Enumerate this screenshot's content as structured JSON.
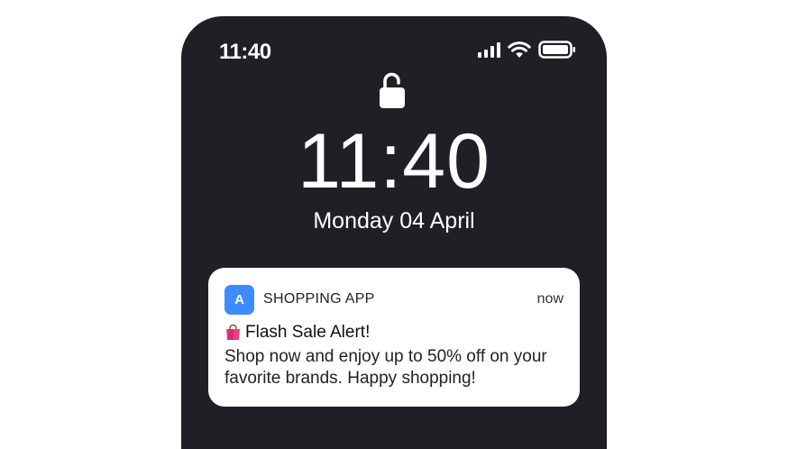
{
  "status_bar": {
    "time": "11:40",
    "icons": [
      "cellular-signal-icon",
      "wifi-icon",
      "battery-icon"
    ]
  },
  "lock_screen": {
    "lock_icon": "unlocked-padlock-icon",
    "time": "11:40",
    "date": "Monday 04 April"
  },
  "notification": {
    "app_icon_letter": "A",
    "app_icon_color": "#3d8bfd",
    "app_name": "SHOPPING APP",
    "time": "now",
    "title_icon": "shopping-bag-icon",
    "title": "Flash Sale Alert!",
    "body": "Shop now and enjoy up to 50% off on your favorite brands. Happy shopping!"
  },
  "colors": {
    "phone_background": "#1f2025",
    "card_background": "#ffffff"
  }
}
